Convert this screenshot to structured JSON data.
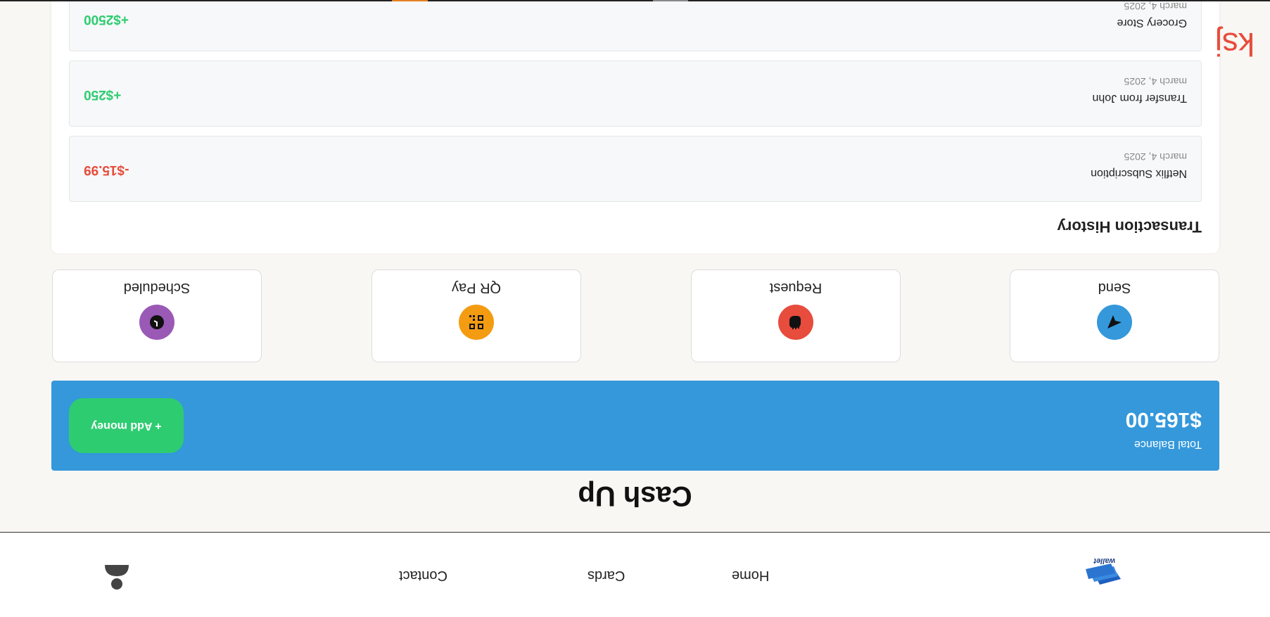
{
  "nav": {
    "logo_text": "wallet",
    "links": [
      "Home",
      "Cards",
      "Contact"
    ]
  },
  "app_title": "Cash Up",
  "balance": {
    "label": "Total Balance",
    "amount": "$165.00",
    "add_button": "+ Add money"
  },
  "actions": [
    {
      "label": "Send",
      "icon": "send-icon",
      "color": "#3498db"
    },
    {
      "label": "Request",
      "icon": "hand-icon",
      "color": "#e74c3c"
    },
    {
      "label": "QR Pay",
      "icon": "qr-code-icon",
      "color": "#f39c12"
    },
    {
      "label": "Scheduled",
      "icon": "clock-icon",
      "color": "#9b59b6"
    }
  ],
  "transactions": {
    "title": "Transaction History",
    "items": [
      {
        "name": "Netflix Subscription",
        "date": "march 4, 2025",
        "amount": "-$15.99",
        "color": "#e74c3c"
      },
      {
        "name": "Transfer from John",
        "date": "march 4, 2025",
        "amount": "+$250",
        "color": "#2ecc71"
      },
      {
        "name": "Grocery Store",
        "date": "march 4, 2025",
        "amount": "+$2500",
        "color": "#2ecc71"
      }
    ]
  },
  "corner_mark": "ksj",
  "colors": {
    "accent": "#3498db",
    "success": "#2ecc71",
    "danger": "#e74c3c",
    "background": "#f9f7f3"
  }
}
